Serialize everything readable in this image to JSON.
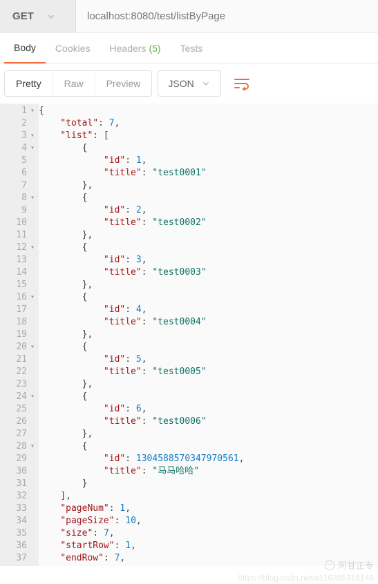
{
  "request": {
    "method": "GET",
    "url": "localhost:8080/test/listByPage"
  },
  "tabs": {
    "body": "Body",
    "cookies": "Cookies",
    "headers": "Headers",
    "headers_count": "(5)",
    "tests": "Tests"
  },
  "viewbar": {
    "pretty": "Pretty",
    "raw": "Raw",
    "preview": "Preview",
    "format": "JSON"
  },
  "json": {
    "total": 7,
    "list": [
      {
        "id": 1,
        "title": "test0001"
      },
      {
        "id": 2,
        "title": "test0002"
      },
      {
        "id": 3,
        "title": "test0003"
      },
      {
        "id": 4,
        "title": "test0004"
      },
      {
        "id": 5,
        "title": "test0005"
      },
      {
        "id": 6,
        "title": "test0006"
      },
      {
        "id": "1304588570347970561",
        "title": "马马哈哈"
      }
    ],
    "pageNum": 1,
    "pageSize": 10,
    "size": 7,
    "startRow": 1,
    "endRow": 7
  },
  "watermark": {
    "name": "阿甘正专",
    "url": "https://blog.csdn.net/a116385318146"
  }
}
